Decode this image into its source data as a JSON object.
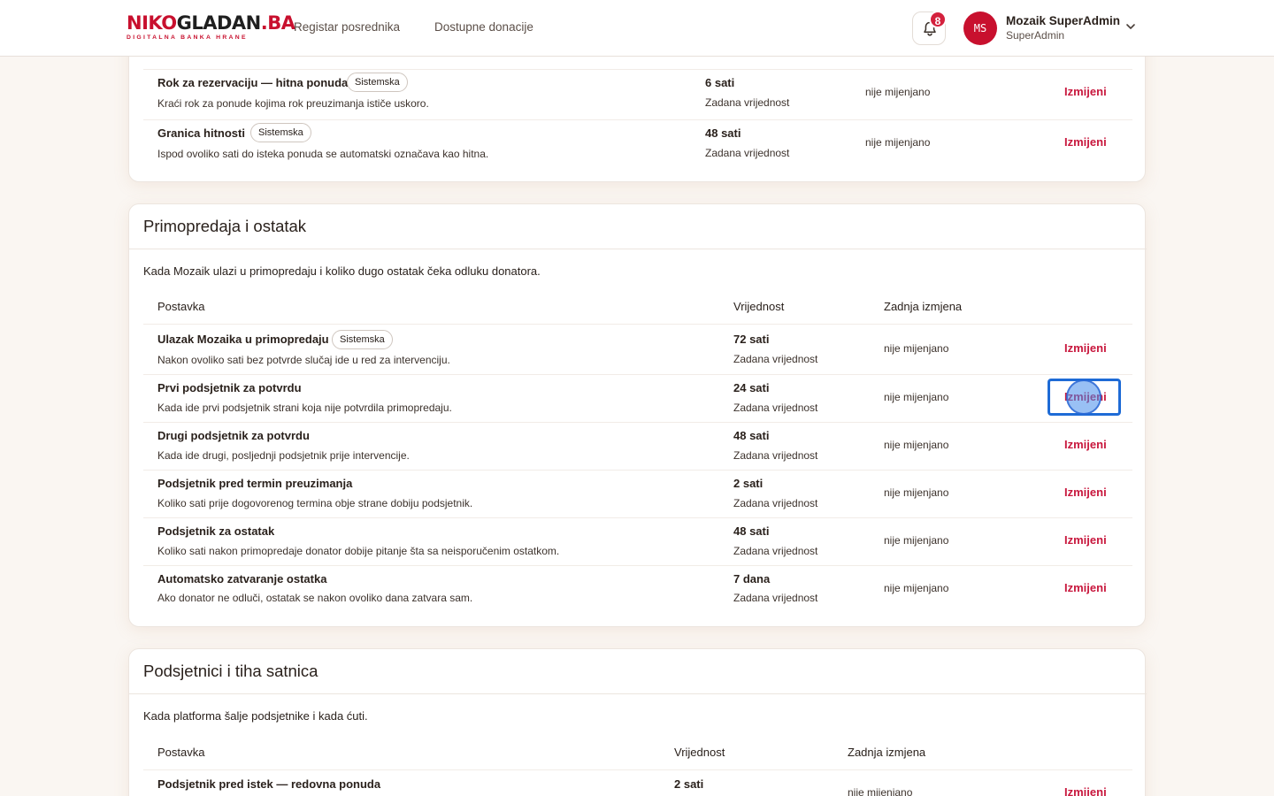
{
  "header": {
    "logo": {
      "part1": "NIKO",
      "part2": "GLADAN",
      "part3": ".BA",
      "tagline": "DIGITALNA BANKA HRANE"
    },
    "nav": [
      "Registar posrednika",
      "Dostupne donacije"
    ],
    "notifications": {
      "icon": "bell-icon",
      "count": "8"
    },
    "user": {
      "initials": "MS",
      "name": "Mozaik SuperAdmin",
      "role": "SuperAdmin",
      "menu_icon": "chevron-down-icon"
    }
  },
  "colors": {
    "brand": "#c8102e",
    "action": "#c8173d",
    "focus": "#1e6bd6"
  },
  "sections": [
    {
      "rows": [
        {
          "name": "Rok za rezervaciju — hitna ponuda",
          "badge": "Sistemska",
          "desc": "Kraći rok za ponude kojima rok preuzimanja ističe uskoro.",
          "value": "6 sati",
          "value_note": "Zadana vrijednost",
          "last_change": "nije mijenjano",
          "action": "Izmijeni"
        },
        {
          "name": "Granica hitnosti",
          "badge": "Sistemska",
          "desc": "Ispod ovoliko sati do isteka ponuda se automatski označava kao hitna.",
          "value": "48 sati",
          "value_note": "Zadana vrijednost",
          "last_change": "nije mijenjano",
          "action": "Izmijeni"
        }
      ]
    },
    {
      "title": "Primopredaja i ostatak",
      "description": "Kada Mozaik ulazi u primopredaju i koliko dugo ostatak čeka odluku donatora.",
      "columns": {
        "setting": "Postavka",
        "value": "Vrijednost",
        "last_change": "Zadnja izmjena"
      },
      "rows": [
        {
          "name": "Ulazak Mozaika u primopredaju",
          "badge": "Sistemska",
          "desc": "Nakon ovoliko sati bez potvrde slučaj ide u red za intervenciju.",
          "value": "72 sati",
          "value_note": "Zadana vrijednost",
          "last_change": "nije mijenjano",
          "action": "Izmijeni"
        },
        {
          "name": "Prvi podsjetnik za potvrdu",
          "desc": "Kada ide prvi podsjetnik strani koja nije potvrdila primopredaju.",
          "value": "24 sati",
          "value_note": "Zadana vrijednost",
          "last_change": "nije mijenjano",
          "action": "Izmijeni"
        },
        {
          "name": "Drugi podsjetnik za potvrdu",
          "desc": "Kada ide drugi, posljednji podsjetnik prije intervencije.",
          "value": "48 sati",
          "value_note": "Zadana vrijednost",
          "last_change": "nije mijenjano",
          "action": "Izmijeni"
        },
        {
          "name": "Podsjetnik pred termin preuzimanja",
          "desc": "Koliko sati prije dogovorenog termina obje strane dobiju podsjetnik.",
          "value": "2 sati",
          "value_note": "Zadana vrijednost",
          "last_change": "nije mijenjano",
          "action": "Izmijeni"
        },
        {
          "name": "Podsjetnik za ostatak",
          "desc": "Koliko sati nakon primopredaje donator dobije pitanje šta sa neisporučenim ostatkom.",
          "value": "48 sati",
          "value_note": "Zadana vrijednost",
          "last_change": "nije mijenjano",
          "action": "Izmijeni"
        },
        {
          "name": "Automatsko zatvaranje ostatka",
          "desc": "Ako donator ne odluči, ostatak se nakon ovoliko dana zatvara sam.",
          "value": "7 dana",
          "value_note": "Zadana vrijednost",
          "last_change": "nije mijenjano",
          "action": "Izmijeni"
        }
      ]
    },
    {
      "title": "Podsjetnici i tiha satnica",
      "description": "Kada platforma šalje podsjetnike i kada ćuti.",
      "columns": {
        "setting": "Postavka",
        "value": "Vrijednost",
        "last_change": "Zadnja izmjena"
      },
      "rows": [
        {
          "name": "Podsjetnik pred istek — redovna ponuda",
          "value": "2 sati",
          "last_change": "nije mijenjano",
          "action": "Izmijeni"
        }
      ]
    }
  ]
}
